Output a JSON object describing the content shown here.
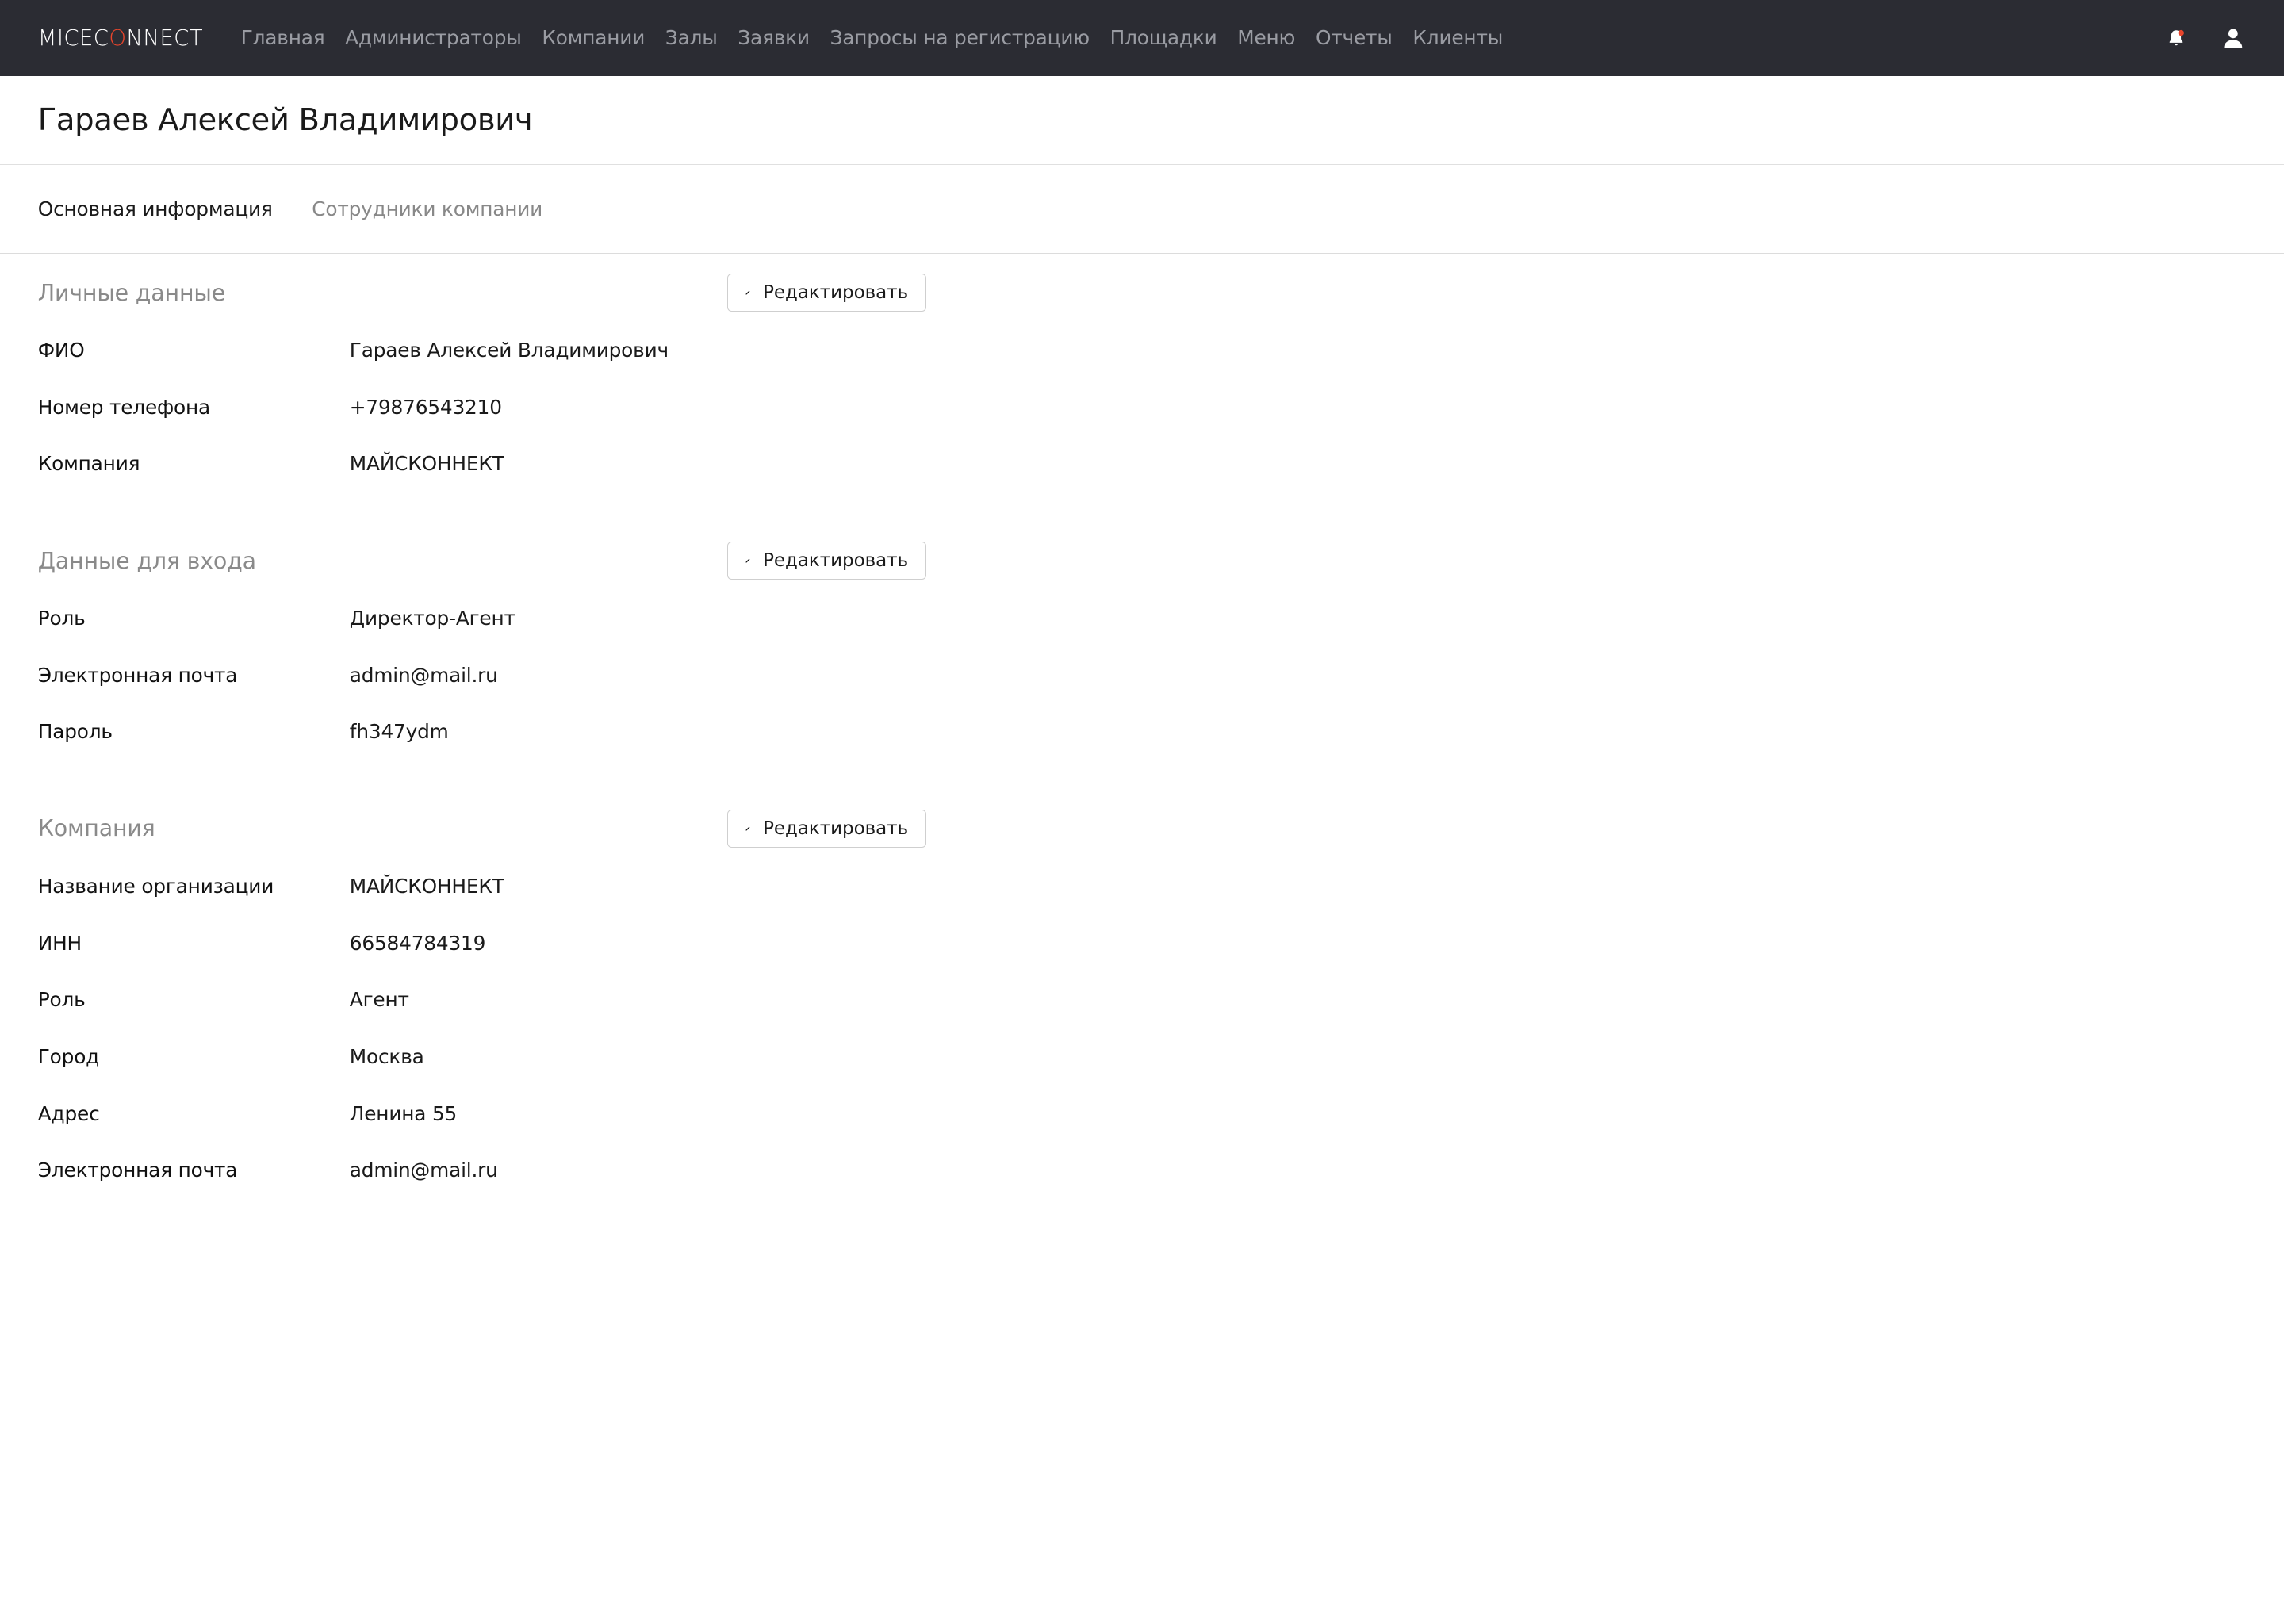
{
  "app": {
    "logo_pre": "MICEC",
    "logo_accent": "O",
    "logo_post": "NNECT"
  },
  "nav": {
    "items": [
      "Главная",
      "Администраторы",
      "Компании",
      "Залы",
      "Заявки",
      "Запросы на регистрацию",
      "Площадки",
      "Меню",
      "Отчеты",
      "Клиенты"
    ]
  },
  "page": {
    "title": "Гараев Алексей Владимирович"
  },
  "tabs": [
    {
      "label": "Основная информация",
      "active": true
    },
    {
      "label": "Сотрудники компании",
      "active": false
    }
  ],
  "edit_label": "Редактировать",
  "sections": [
    {
      "title": "Личные данные",
      "rows": [
        {
          "label": "ФИО",
          "value": "Гараев Алексей Владимирович"
        },
        {
          "label": "Номер телефона",
          "value": "+79876543210"
        },
        {
          "label": "Компания",
          "value": "МАЙСКОННЕКТ"
        }
      ]
    },
    {
      "title": "Данные для входа",
      "rows": [
        {
          "label": "Роль",
          "value": "Директор-Агент"
        },
        {
          "label": "Электронная почта",
          "value": "admin@mail.ru"
        },
        {
          "label": "Пароль",
          "value": "fh347ydm"
        }
      ]
    },
    {
      "title": "Компания",
      "rows": [
        {
          "label": "Название организации",
          "value": "МАЙСКОННЕКТ"
        },
        {
          "label": "ИНН",
          "value": "66584784319"
        },
        {
          "label": "Роль",
          "value": "Агент"
        },
        {
          "label": "Город",
          "value": "Москва"
        },
        {
          "label": "Адрес",
          "value": "Ленина 55"
        },
        {
          "label": "Электронная почта",
          "value": "admin@mail.ru"
        }
      ]
    }
  ],
  "colors": {
    "navbar_bg": "#2b2c33",
    "logo_accent": "#e8452c",
    "nav_text": "#9a9ca3"
  },
  "icons": {
    "notification": "bell-icon",
    "user": "user-icon",
    "edit": "pencil-icon"
  }
}
